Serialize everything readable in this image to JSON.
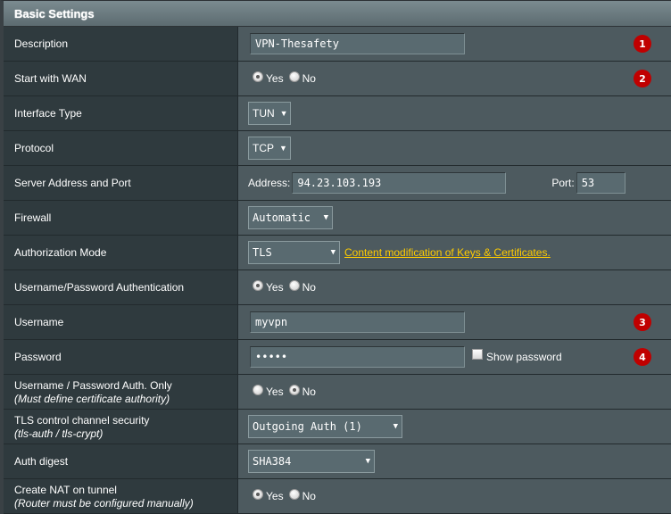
{
  "section": {
    "title": "Basic Settings"
  },
  "rows": {
    "description": {
      "label": "Description",
      "value": "VPN-Thesafety",
      "badge": "1"
    },
    "start_with_wan": {
      "label": "Start with WAN",
      "options": [
        "Yes",
        "No"
      ],
      "selected": "Yes",
      "badge": "2"
    },
    "interface_type": {
      "label": "Interface Type",
      "value": "TUN"
    },
    "protocol": {
      "label": "Protocol",
      "value": "TCP"
    },
    "server": {
      "label": "Server Address and Port",
      "address_label": "Address:",
      "address": "94.23.103.193",
      "port_label": "Port:",
      "port": "53"
    },
    "firewall": {
      "label": "Firewall",
      "value": "Automatic"
    },
    "auth_mode": {
      "label": "Authorization Mode",
      "value": "TLS",
      "link": "Content modification of Keys & Certificates."
    },
    "userpass_auth": {
      "label": "Username/Password Authentication",
      "options": [
        "Yes",
        "No"
      ],
      "selected": "Yes"
    },
    "username": {
      "label": "Username",
      "value": "myvpn",
      "badge": "3"
    },
    "password": {
      "label": "Password",
      "value": "•••••",
      "show_password_label": "Show password",
      "show_password_checked": false,
      "badge": "4"
    },
    "userpass_only": {
      "label": "Username / Password Auth. Only",
      "sublabel": "(Must define certificate authority)",
      "options": [
        "Yes",
        "No"
      ],
      "selected": "No"
    },
    "tls_control": {
      "label": "TLS control channel security",
      "sublabel": "(tls-auth / tls-crypt)",
      "value": "Outgoing Auth (1)"
    },
    "auth_digest": {
      "label": "Auth digest",
      "value": "SHA384"
    },
    "create_nat": {
      "label": "Create NAT on tunnel",
      "sublabel": "(Router must be configured manually)",
      "options": [
        "Yes",
        "No"
      ],
      "selected": "Yes"
    }
  },
  "colors": {
    "badge": "#c00000",
    "link": "#ffcc00"
  }
}
